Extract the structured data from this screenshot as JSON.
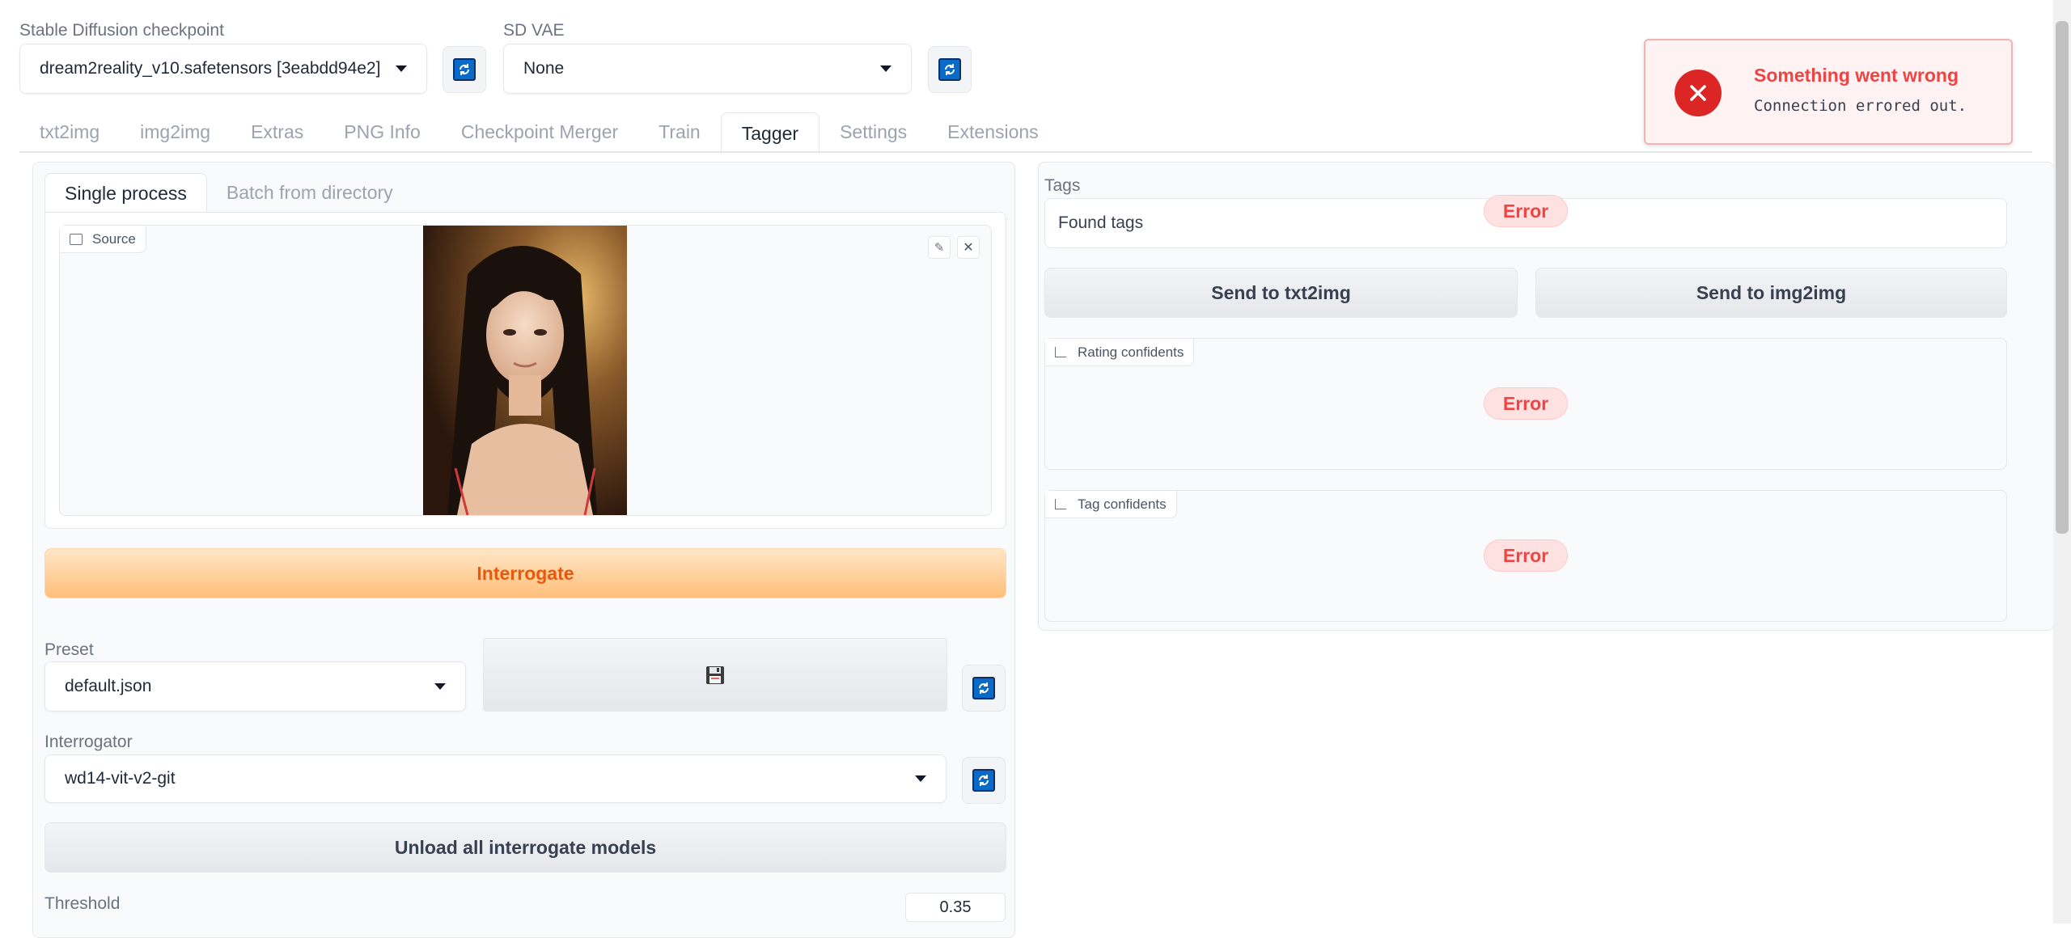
{
  "top": {
    "checkpoint_label": "Stable Diffusion checkpoint",
    "checkpoint_value": "dream2reality_v10.safetensors [3eabdd94e2]",
    "vae_label": "SD VAE",
    "vae_value": "None"
  },
  "tabs": [
    {
      "label": "txt2img"
    },
    {
      "label": "img2img"
    },
    {
      "label": "Extras"
    },
    {
      "label": "PNG Info"
    },
    {
      "label": "Checkpoint Merger"
    },
    {
      "label": "Train"
    },
    {
      "label": "Tagger",
      "active": true
    },
    {
      "label": "Settings"
    },
    {
      "label": "Extensions"
    }
  ],
  "left": {
    "subtabs": [
      {
        "label": "Single process",
        "active": true
      },
      {
        "label": "Batch from directory"
      }
    ],
    "source_label": "Source",
    "interrogate_label": "Interrogate",
    "preset_label": "Preset",
    "preset_value": "default.json",
    "save_icon": "floppy-disk-icon",
    "interrogator_label": "Interrogator",
    "interrogator_value": "wd14-vit-v2-git",
    "unload_label": "Unload all interrogate models",
    "threshold_label": "Threshold",
    "threshold_value": "0.35"
  },
  "right": {
    "tags_label": "Tags",
    "tags_placeholder": "Found tags",
    "send_txt2img": "Send to txt2img",
    "send_img2img": "Send to img2img",
    "rating_label": "Rating confidents",
    "tag_conf_label": "Tag confidents",
    "error_text": "Error"
  },
  "toast": {
    "title": "Something went wrong",
    "message": "Connection errored out."
  },
  "colors": {
    "accent_orange": "#ea580c",
    "error_red": "#dc2626",
    "refresh_blue": "#0a6ac7"
  }
}
